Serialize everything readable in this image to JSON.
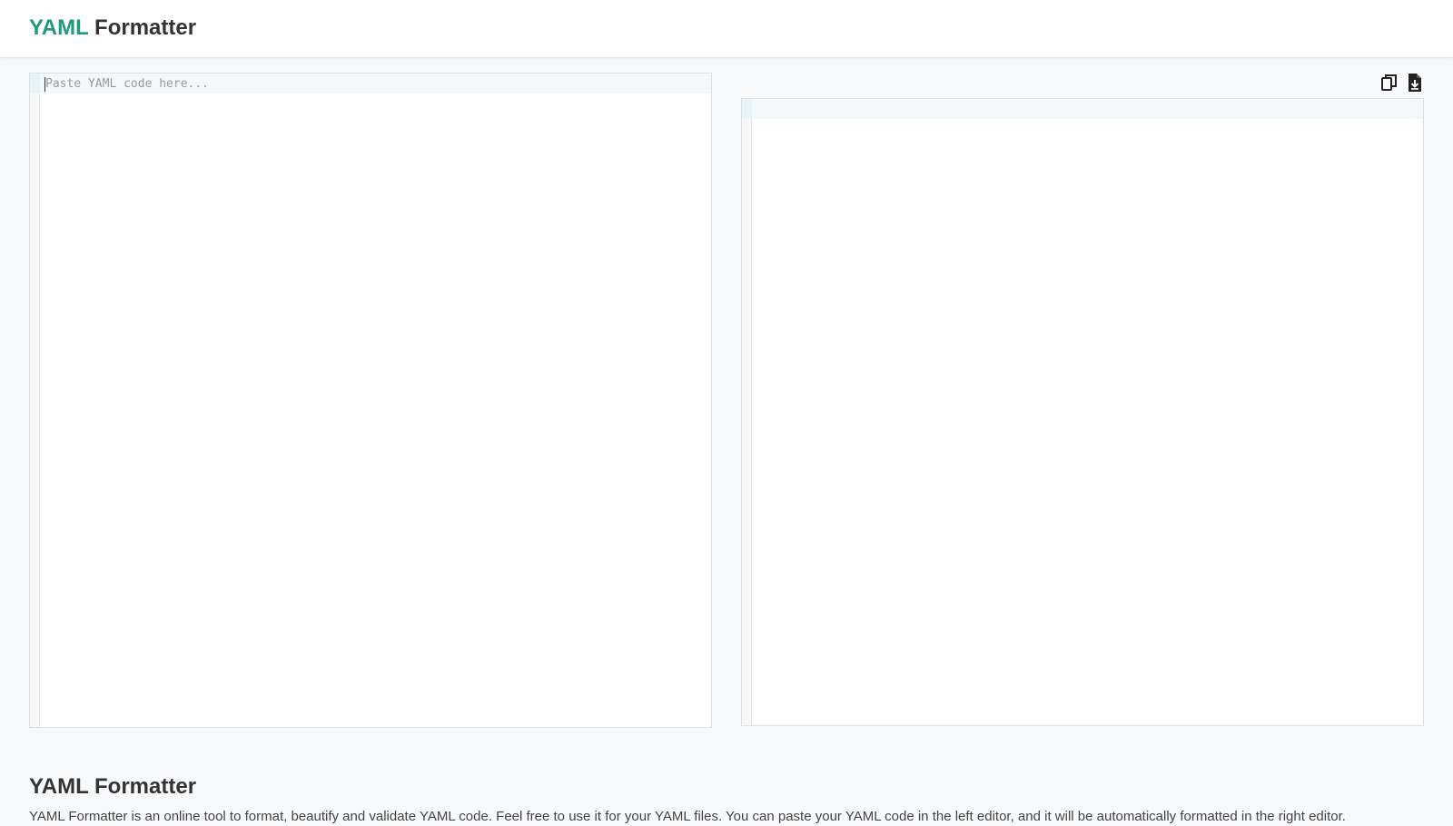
{
  "header": {
    "brand_accent": "YAML",
    "brand_rest": "Formatter",
    "accent_color": "#1f9a7c"
  },
  "input_editor": {
    "placeholder": "Paste YAML code here...",
    "value": ""
  },
  "output_editor": {
    "value": ""
  },
  "toolbar": {
    "copy_icon": "copy-icon",
    "download_icon": "download-file-icon"
  },
  "about": {
    "title": "YAML Formatter",
    "description": "YAML Formatter is an online tool to format, beautify and validate YAML code. Feel free to use it for your YAML files. You can paste your YAML code in the left editor, and it will be automatically formatted in the right editor."
  }
}
